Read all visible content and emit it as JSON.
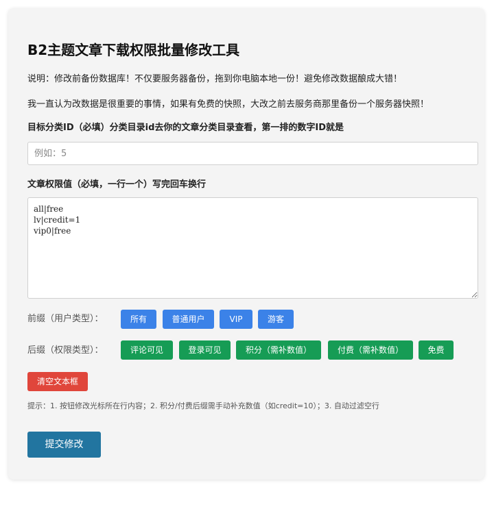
{
  "header": {
    "title": "B2主题文章下载权限批量修改工具"
  },
  "notes": [
    "说明：修改前备份数据库！不仅要服务器备份，拖到你电脑本地一份！避免修改数据酿成大错！",
    "我一直认为改数据是很重要的事情，如果有免费的快照，大改之前去服务商那里备份一个服务器快照！"
  ],
  "category": {
    "label": "目标分类ID（必填）分类目录id去你的文章分类目录查看，第一排的数字ID就是",
    "placeholder": "例如：5",
    "value": ""
  },
  "permissions": {
    "label": "文章权限值（必填，一行一个）写完回车换行",
    "value": "all|free\nlv|credit=1\nvip0|free"
  },
  "prefix": {
    "label": "前缀（用户类型）：",
    "buttons": [
      "所有",
      "普通用户",
      "VIP",
      "游客"
    ]
  },
  "suffix": {
    "label": "后缀（权限类型）：",
    "buttons": [
      "评论可见",
      "登录可见",
      "积分（需补数值）",
      "付费（需补数值）",
      "免费"
    ]
  },
  "actions": {
    "clear_label": "清空文本框",
    "submit_label": "提交修改"
  },
  "hint": "提示：1. 按钮修改光标所在行内容；2. 积分/付费后缀需手动补充数值（如credit=10）；3. 自动过滤空行",
  "colors": {
    "prefix_button": "#3b82e8",
    "suffix_button": "#169c55",
    "clear_button": "#e0463b",
    "submit_button": "#2275a0"
  }
}
